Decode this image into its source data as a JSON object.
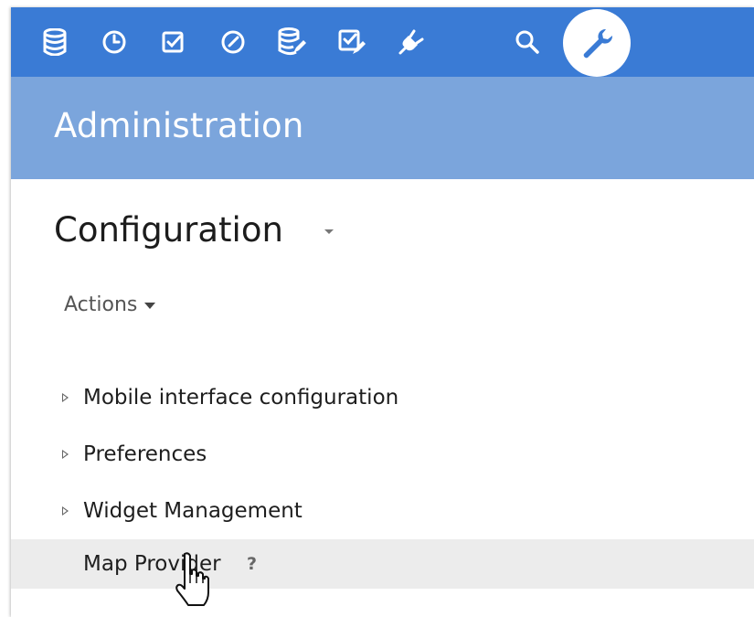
{
  "nav": {
    "icons": [
      {
        "name": "database-icon"
      },
      {
        "name": "clock-icon"
      },
      {
        "name": "checkbox-icon"
      },
      {
        "name": "gauge-icon"
      },
      {
        "name": "database-edit-icon"
      },
      {
        "name": "checklist-edit-icon"
      },
      {
        "name": "plug-icon"
      },
      {
        "name": "search-icon"
      },
      {
        "name": "wrench-icon",
        "active": true
      }
    ],
    "bar_color": "#3a7bd5",
    "subheader_color": "#7ba5dc"
  },
  "header": {
    "title": "Administration"
  },
  "page": {
    "title": "Configuration",
    "actions_label": "Actions"
  },
  "tree": {
    "items": [
      {
        "label": "Mobile interface configuration",
        "expandable": true
      },
      {
        "label": "Preferences",
        "expandable": true
      },
      {
        "label": "Widget Management",
        "expandable": true
      },
      {
        "label": "Map Provider",
        "expandable": false,
        "selected": true,
        "help": "?"
      }
    ]
  }
}
